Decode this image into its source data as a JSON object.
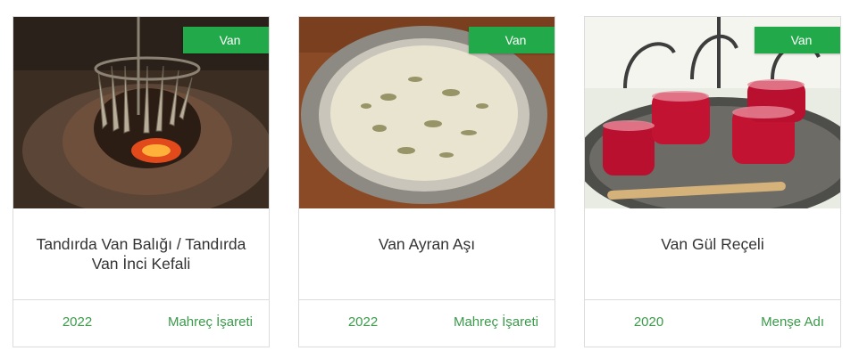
{
  "cards": [
    {
      "region": "Van",
      "title": "Tandırda Van Balığı / Tandırda Van İnci Kefali",
      "year": "2022",
      "type": "Mahreç İşareti",
      "image": "fish-in-tandoor-photo"
    },
    {
      "region": "Van",
      "title": "Van Ayran Aşı",
      "year": "2022",
      "type": "Mahreç İşareti",
      "image": "ayran-soup-bowl-photo"
    },
    {
      "region": "Van",
      "title": "Van Gül Reçeli",
      "year": "2020",
      "type": "Menşe Adı",
      "image": "rose-jam-glasses-photo"
    }
  ],
  "colors": {
    "ribbon": "#22a94a",
    "accent_text": "#3a9a4a",
    "border": "#dcdcdc"
  }
}
